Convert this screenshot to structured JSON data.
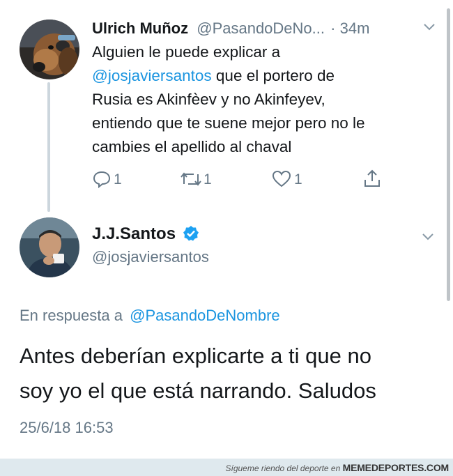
{
  "tweet1": {
    "display_name": "Ulrich Muñoz",
    "handle": "@PasandoDeNo...",
    "separator": "·",
    "time": "34m",
    "text_line1": "Alguien le puede explicar a",
    "mention": "@josjaviersantos",
    "text_line2_rest": " que el portero de",
    "text_line3": "Rusia es Akinfèev y no Akinfeyev,",
    "text_line4": "entiendo que te suene mejor pero no le",
    "text_line5": "cambies el apellido al chaval",
    "reply_count": "1",
    "retweet_count": "1",
    "like_count": "1"
  },
  "tweet2": {
    "display_name": "J.J.Santos",
    "handle": "@josjaviersantos",
    "verified": true,
    "reply_to_prefix": "En respuesta a",
    "reply_to_handle": "@PasandoDeNombre",
    "text_line1": "Antes deberían explicarte a ti que no",
    "text_line2": "soy yo el que está narrando. Saludos",
    "timestamp": "25/6/18 16:53"
  },
  "watermark": {
    "prefix": "Sígueте riendo del deporte en",
    "brand": "MEMEDEPORTES.COM"
  },
  "colors": {
    "link": "#1b95e0",
    "verified": "#1da1f2",
    "muted": "#657786"
  },
  "icons": [
    "reply-icon",
    "retweet-icon",
    "like-icon",
    "share-icon",
    "chevron-down-icon",
    "verified-badge-icon"
  ]
}
